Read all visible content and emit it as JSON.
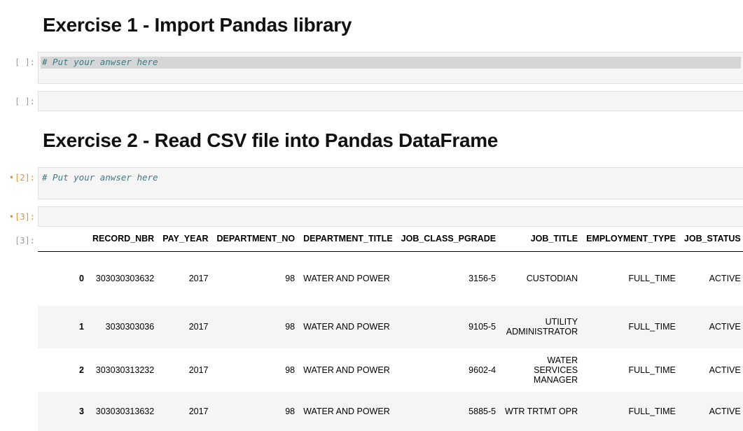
{
  "exercise1": {
    "heading": "Exercise 1 - Import Pandas library",
    "cell1_prompt": "[ ]:",
    "cell1_code": "# Put your anwser here",
    "cell2_prompt": "[ ]:"
  },
  "exercise2": {
    "heading": "Exercise 2 - Read CSV file into Pandas DataFrame",
    "cell1_dot": "•",
    "cell1_prompt": "[2]:",
    "cell1_code": "# Put your anwser here",
    "cell2_dot": "•",
    "cell2_prompt": "[3]:",
    "output_prompt": "[3]:"
  },
  "colors": {
    "accent": "#e7902f",
    "code_comment": "#3b7a86"
  },
  "table": {
    "columns": [
      "",
      "RECORD_NBR",
      "PAY_YEAR",
      "DEPARTMENT_NO",
      "DEPARTMENT_TITLE",
      "JOB_CLASS_PGRADE",
      "JOB_TITLE",
      "EMPLOYMENT_TYPE",
      "JOB_STATUS"
    ],
    "rows": [
      [
        "0",
        "303030303632",
        "2017",
        "98",
        "WATER AND POWER",
        "3156-5",
        "CUSTODIAN",
        "FULL_TIME",
        "ACTIVE"
      ],
      [
        "1",
        "3030303036",
        "2017",
        "98",
        "WATER AND POWER",
        "9105-5",
        "UTILITY ADMINISTRATOR",
        "FULL_TIME",
        "ACTIVE"
      ],
      [
        "2",
        "303030313232",
        "2017",
        "98",
        "WATER AND POWER",
        "9602-4",
        "WATER SERVICES MANAGER",
        "FULL_TIME",
        "ACTIVE"
      ],
      [
        "3",
        "303030313632",
        "2017",
        "98",
        "WATER AND POWER",
        "5885-5",
        "WTR TRTMT OPR",
        "FULL_TIME",
        "ACTIVE"
      ]
    ]
  }
}
